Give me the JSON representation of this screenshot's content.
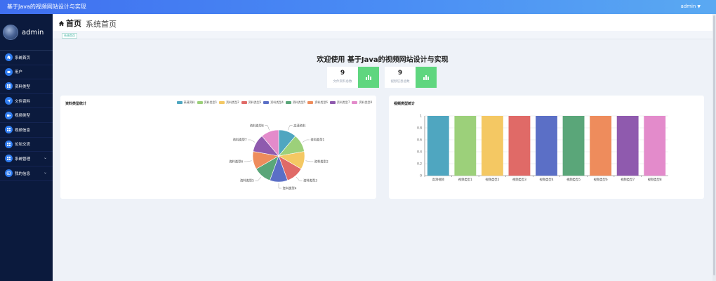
{
  "app": {
    "title": "基于Java的视频网站设计与实现"
  },
  "user_menu": {
    "label": "admin"
  },
  "sidebar": {
    "profile_name": "admin",
    "items": [
      {
        "label": "系统首页",
        "icon": "home-icon",
        "has_chevron": false
      },
      {
        "label": "用户",
        "icon": "user-icon",
        "has_chevron": false
      },
      {
        "label": "资料类型",
        "icon": "grid-icon",
        "has_chevron": false
      },
      {
        "label": "文件资料",
        "icon": "send-icon",
        "has_chevron": false
      },
      {
        "label": "视频类型",
        "icon": "video-icon",
        "has_chevron": false
      },
      {
        "label": "视频信息",
        "icon": "grid-icon",
        "has_chevron": false
      },
      {
        "label": "论坛交流",
        "icon": "grid-icon",
        "has_chevron": false
      },
      {
        "label": "系统管理",
        "icon": "grid-icon",
        "has_chevron": true
      },
      {
        "label": "我的信息",
        "icon": "id-card-icon",
        "has_chevron": true
      }
    ]
  },
  "header": {
    "home_label": "首页",
    "page_title": "系统首页"
  },
  "breadcrumb": {
    "tag": "系统首页"
  },
  "welcome": "欢迎使用 基于Java的视频网站设计与实现",
  "stats": [
    {
      "value": "9",
      "label": "文件资料总数"
    },
    {
      "value": "9",
      "label": "视频信息总数"
    }
  ],
  "colors": [
    "#4fa6c0",
    "#9cd07a",
    "#f4c863",
    "#e06a67",
    "#5b6fc6",
    "#5aa679",
    "#ee8c5c",
    "#8f5aae",
    "#e38bcb"
  ],
  "chart_data": [
    {
      "type": "pie",
      "title": "资料类型统计",
      "categories": [
        "高清资料",
        "资料类型1",
        "资料类型2",
        "资料类型3",
        "资料类型4",
        "资料类型5",
        "资料类型6",
        "资料类型7",
        "资料类型8"
      ],
      "legend": [
        "高清资料",
        "资料类型1",
        "资料类型2",
        "资料类型3",
        "资料类型4",
        "资料类型5",
        "资料类型6",
        "资料类型7",
        "资料类型8"
      ],
      "values": [
        1,
        1,
        1,
        1,
        1,
        1,
        1,
        1,
        1
      ]
    },
    {
      "type": "bar",
      "title": "视频类型统计",
      "categories": [
        "高清视频",
        "视频类型1",
        "视频类型2",
        "视频类型3",
        "视频类型4",
        "视频类型5",
        "视频类型6",
        "视频类型7",
        "视频类型8"
      ],
      "values": [
        1,
        1,
        1,
        1,
        1,
        1,
        1,
        1,
        1
      ],
      "ylim": [
        0,
        1
      ],
      "yticks": [
        "0",
        "0.2",
        "0.4",
        "0.6",
        "0.8",
        "1"
      ],
      "grid": true
    }
  ]
}
